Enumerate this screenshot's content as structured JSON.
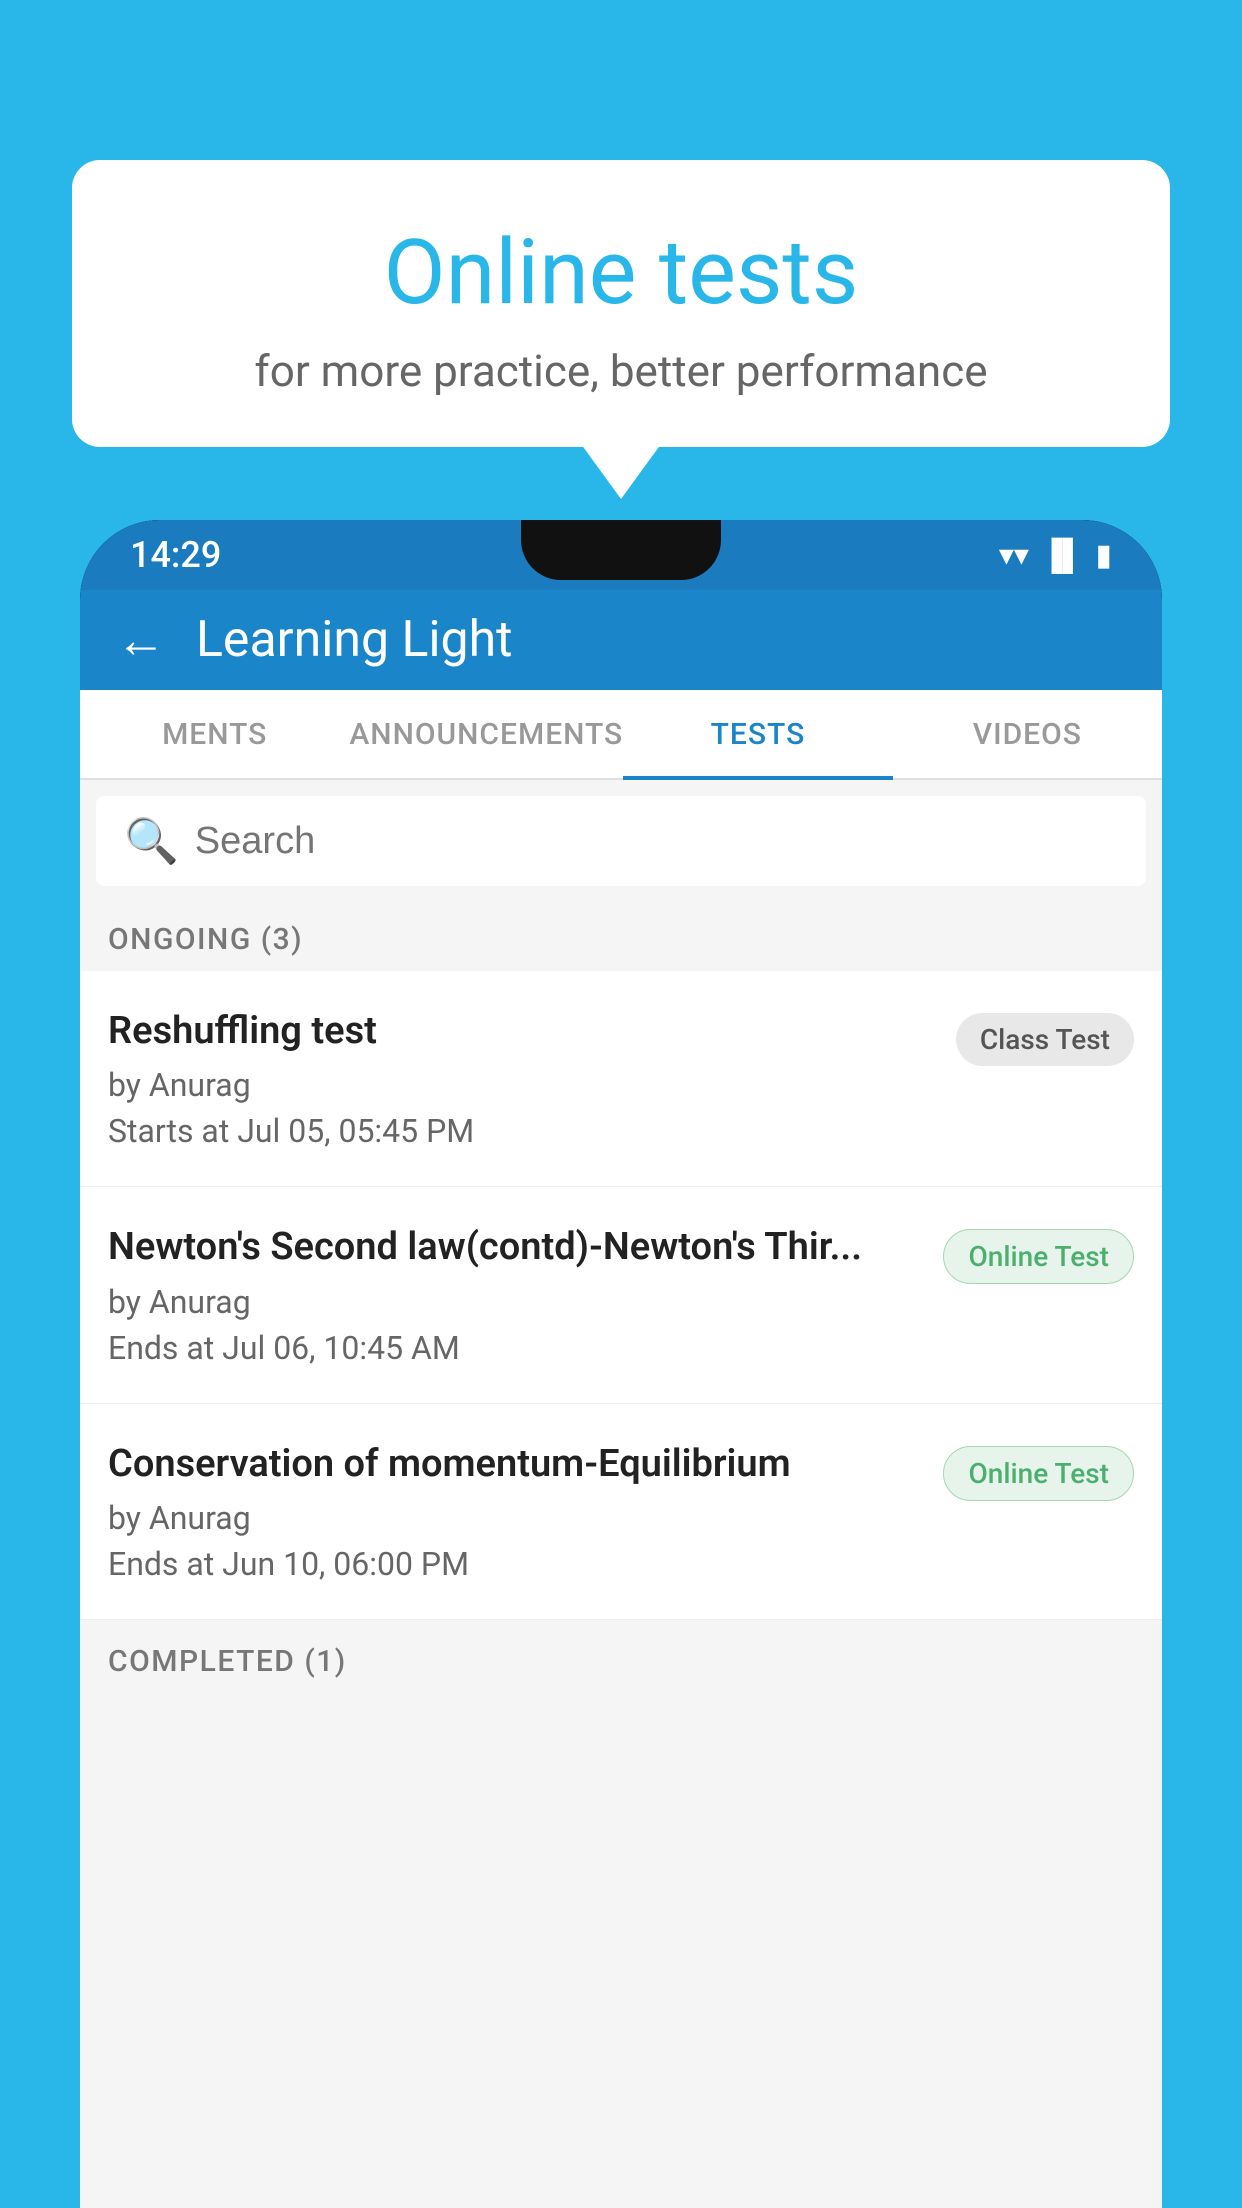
{
  "background": {
    "color": "#29b6e8"
  },
  "bubble": {
    "title": "Online tests",
    "subtitle": "for more practice, better performance"
  },
  "phone": {
    "status_bar": {
      "time": "14:29",
      "icons": [
        "▼",
        "▲",
        "▌"
      ]
    },
    "header": {
      "back_label": "←",
      "title": "Learning Light"
    },
    "tabs": [
      {
        "label": "MENTS",
        "active": false
      },
      {
        "label": "ANNOUNCEMENTS",
        "active": false
      },
      {
        "label": "TESTS",
        "active": true
      },
      {
        "label": "VIDEOS",
        "active": false
      }
    ],
    "search": {
      "placeholder": "Search"
    },
    "ongoing_section": {
      "label": "ONGOING (3)"
    },
    "tests": [
      {
        "name": "Reshuffling test",
        "author": "by Anurag",
        "time_label": "Starts at",
        "time": "Jul 05, 05:45 PM",
        "badge": "Class Test",
        "badge_type": "class"
      },
      {
        "name": "Newton's Second law(contd)-Newton's Thir...",
        "author": "by Anurag",
        "time_label": "Ends at",
        "time": "Jul 06, 10:45 AM",
        "badge": "Online Test",
        "badge_type": "online"
      },
      {
        "name": "Conservation of momentum-Equilibrium",
        "author": "by Anurag",
        "time_label": "Ends at",
        "time": "Jun 10, 06:00 PM",
        "badge": "Online Test",
        "badge_type": "online"
      }
    ],
    "completed_section": {
      "label": "COMPLETED (1)"
    }
  }
}
